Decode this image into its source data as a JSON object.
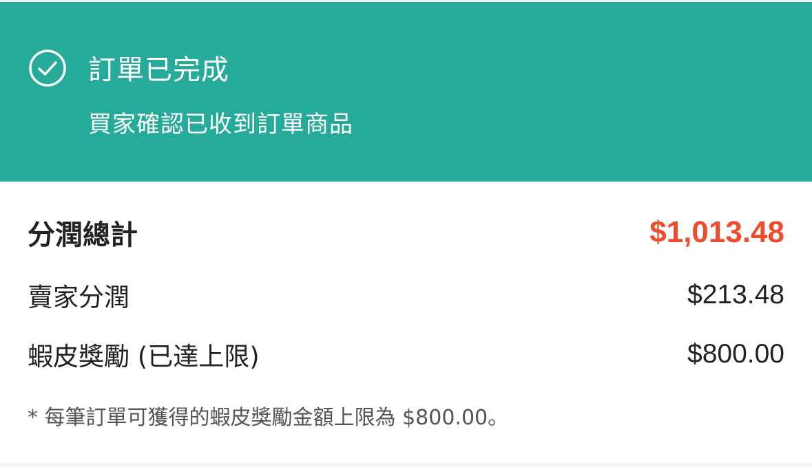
{
  "status": {
    "icon": "check-circle-icon",
    "title": "訂單已完成",
    "subtitle": "買家確認已收到訂單商品"
  },
  "earnings": {
    "total_label": "分潤總計",
    "total_value": "$1,013.48",
    "seller_label": "賣家分潤",
    "seller_value": "$213.48",
    "bonus_label": "蝦皮獎勵 (已達上限)",
    "bonus_value": "$800.00",
    "footnote": "* 每筆訂單可獲得的蝦皮獎勵金額上限為 $800.00。"
  },
  "colors": {
    "banner": "#26ab9a",
    "accent": "#ee4d2d"
  }
}
